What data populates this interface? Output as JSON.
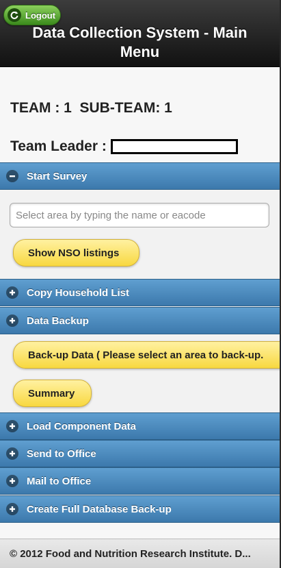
{
  "header": {
    "title": "Data Collection System - Main Menu",
    "logout_label": "Logout"
  },
  "team": {
    "team_line": "TEAM : 1  SUB-TEAM: 1",
    "leader_label": "Team Leader :"
  },
  "sections": {
    "start_survey": "Start Survey",
    "copy_household": "Copy Household List",
    "data_backup": "Data Backup",
    "load_component": "Load Component Data",
    "send_office": "Send to Office",
    "mail_office": "Mail to Office",
    "full_backup": "Create Full Database Back-up"
  },
  "start_survey_panel": {
    "search_placeholder": "Select area by typing the name or eacode",
    "show_nso_label": "Show NSO listings"
  },
  "data_backup_panel": {
    "backup_label": "Back-up Data ( Please select an area to back-up.",
    "summary_label": "Summary"
  },
  "footer": {
    "text": "© 2012 Food and Nutrition Research Institute. D..."
  },
  "colors": {
    "header_bg": "#1a1a1a",
    "section_bg": "#4a8bc0",
    "button_yellow": "#fbe26a",
    "logout_green": "#5aa830"
  },
  "icons": {
    "logout": "refresh-icon",
    "collapse": "minus-circle-icon",
    "expand": "plus-circle-icon"
  }
}
